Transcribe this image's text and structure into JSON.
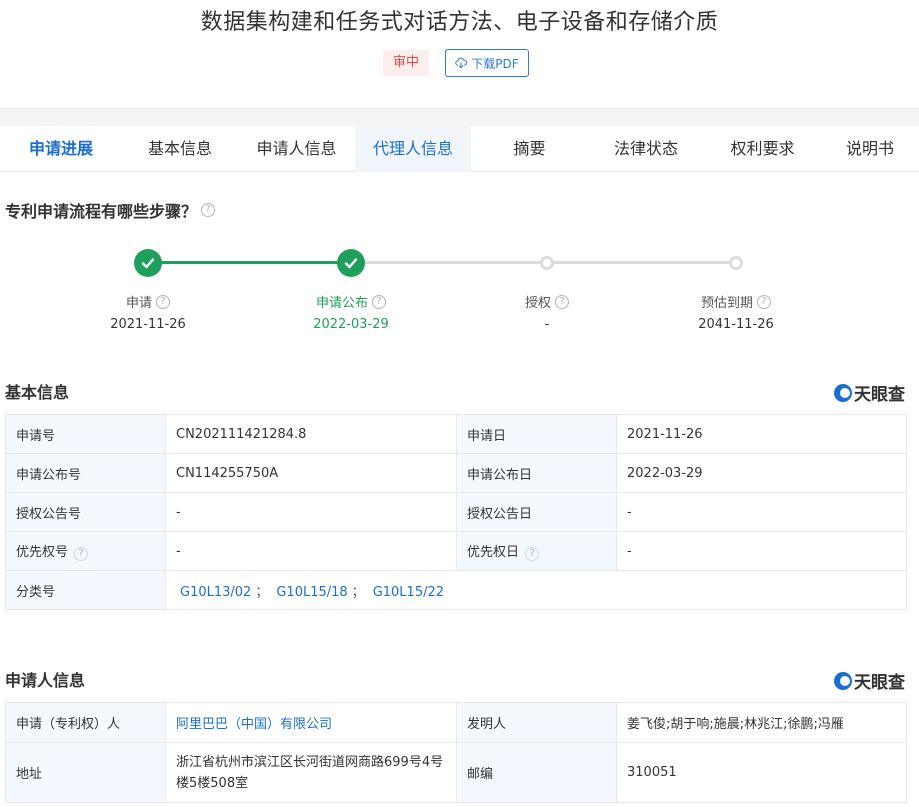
{
  "header": {
    "title": "数据集构建和任务式对话方法、电子设备和存储介质",
    "status": "审中",
    "pdf_label": "下载PDF"
  },
  "tabs": [
    {
      "label": "申请进展",
      "state": "active"
    },
    {
      "label": "基本信息",
      "state": ""
    },
    {
      "label": "申请人信息",
      "state": ""
    },
    {
      "label": "代理人信息",
      "state": "hover"
    },
    {
      "label": "摘要",
      "state": ""
    },
    {
      "label": "法律状态",
      "state": ""
    },
    {
      "label": "权利要求",
      "state": ""
    },
    {
      "label": "说明书",
      "state": ""
    }
  ],
  "process": {
    "question": "专利申请流程有哪些步骤？",
    "steps": [
      {
        "label": "申请",
        "date": "2021-11-26",
        "done": true,
        "current": false
      },
      {
        "label": "申请公布",
        "date": "2022-03-29",
        "done": true,
        "current": true
      },
      {
        "label": "授权",
        "date": "-",
        "done": false,
        "current": false
      },
      {
        "label": "预估到期",
        "date": "2041-11-26",
        "done": false,
        "current": false
      }
    ],
    "colors": {
      "done": "#1fa05a",
      "todo": "#dcdcdc"
    }
  },
  "basic_info": {
    "title": "基本信息",
    "brand": "天眼查",
    "rows": [
      {
        "k1": "申请号",
        "v1": "CN202111421284.8",
        "k2": "申请日",
        "v2": "2021-11-26"
      },
      {
        "k1": "申请公布号",
        "v1": "CN114255750A",
        "k2": "申请公布日",
        "v2": "2022-03-29"
      },
      {
        "k1": "授权公告号",
        "v1": "-",
        "k2": "授权公告日",
        "v2": "-"
      },
      {
        "k1": "优先权号",
        "v1": "-",
        "k2": "优先权日",
        "v2": "-"
      }
    ],
    "classification_label": "分类号",
    "classifications": [
      "G10L13/02",
      "G10L15/18",
      "G10L15/22"
    ],
    "classification_sep": "；"
  },
  "applicant_info": {
    "title": "申请人信息",
    "brand": "天眼查",
    "applicant_label": "申请（专利权）人",
    "applicant": "阿里巴巴（中国）有限公司",
    "inventor_label": "发明人",
    "inventors": "姜飞俊;胡于响;施晨;林兆江;徐鹏;冯雁",
    "address_label": "地址",
    "address": "浙江省杭州市滨江区长河街道网商路699号4号楼5楼508室",
    "postcode_label": "邮编",
    "postcode": "310051"
  },
  "colors": {
    "accent": "#1a6fd0",
    "status_red": "#e04b4b",
    "key_bg": "#f4f9ff"
  }
}
